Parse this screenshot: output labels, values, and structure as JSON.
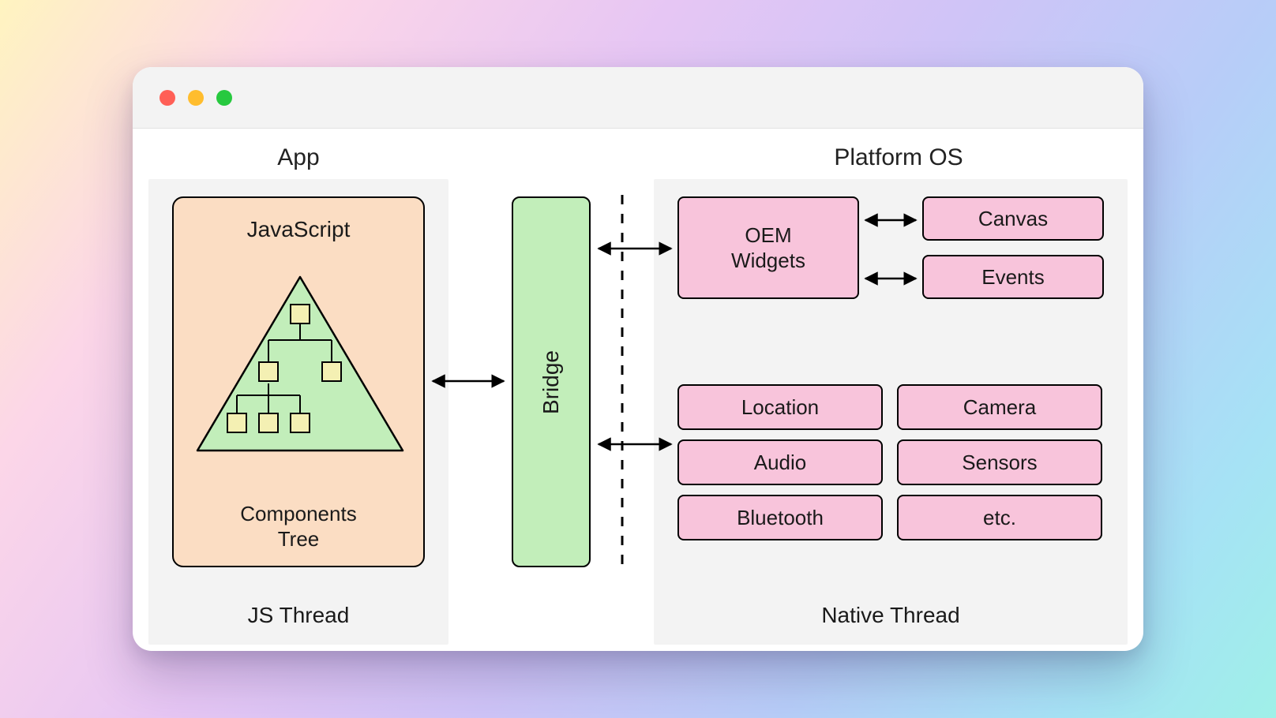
{
  "headings": {
    "app": "App",
    "platform_os": "Platform OS"
  },
  "footers": {
    "js_thread": "JS Thread",
    "native_thread": "Native Thread"
  },
  "js_box": {
    "title": "JavaScript",
    "subtitle_line1": "Components",
    "subtitle_line2": "Tree"
  },
  "bridge": {
    "label": "Bridge"
  },
  "os_widgets": {
    "oem_line1": "OEM",
    "oem_line2": "Widgets",
    "canvas": "Canvas",
    "events": "Events"
  },
  "native_services": {
    "location": "Location",
    "camera": "Camera",
    "audio": "Audio",
    "sensors": "Sensors",
    "bluetooth": "Bluetooth",
    "etc": "etc."
  },
  "colors": {
    "js_box_bg": "#fbddc3",
    "bridge_bg": "#c2eeba",
    "pink_bg": "#f8c4db",
    "panel_bg": "#f3f3f3"
  }
}
